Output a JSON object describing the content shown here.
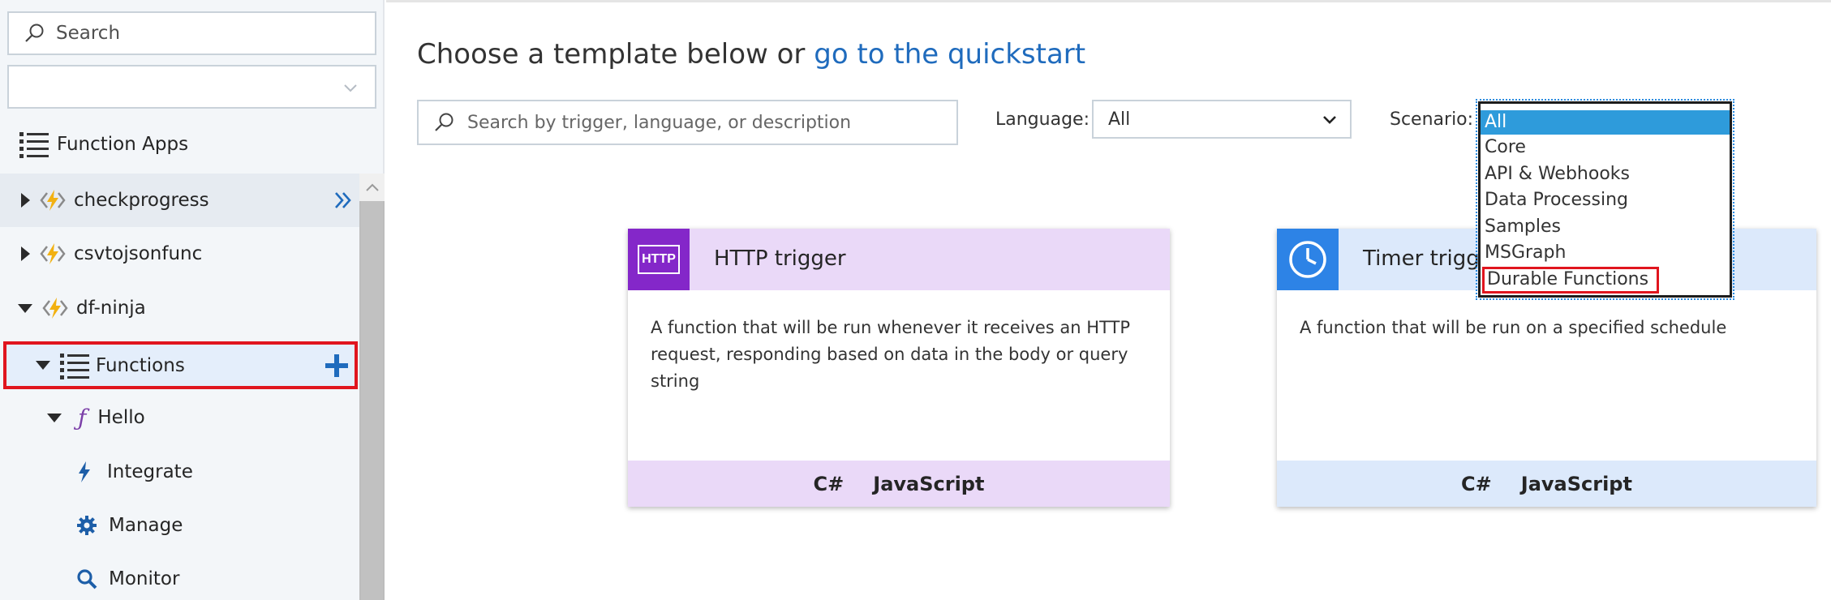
{
  "sidebar": {
    "search_placeholder": "Search",
    "subscription_value": "",
    "function_apps_label": "Function Apps",
    "tree": [
      {
        "label": "checkprogress"
      },
      {
        "label": "csvtojsonfunc"
      },
      {
        "label": "df-ninja"
      },
      {
        "label": "Functions"
      },
      {
        "label": "Hello"
      },
      {
        "label": "Integrate"
      },
      {
        "label": "Manage"
      },
      {
        "label": "Monitor"
      }
    ]
  },
  "main": {
    "heading_text": "Choose a template below or",
    "heading_link": "go to the quickstart",
    "search_placeholder": "Search by trigger, language, or description",
    "language_label": "Language:",
    "language_value": "All",
    "scenario_label": "Scenario:",
    "scenario_options": [
      "All",
      "Core",
      "API & Webhooks",
      "Data Processing",
      "Samples",
      "MSGraph",
      "Durable Functions"
    ]
  },
  "cards": [
    {
      "title": "HTTP trigger",
      "icon_text": "HTTP",
      "description": "A function that will be run whenever it receives an HTTP request, responding based on data in the body or query string",
      "languages": [
        "C#",
        "JavaScript"
      ]
    },
    {
      "title": "Timer trigger",
      "description": "A function that will be run on a specified schedule",
      "languages": [
        "C#",
        "JavaScript"
      ]
    }
  ],
  "colors": {
    "accent_blue": "#1f6bbd",
    "highlight_red": "#e0151e",
    "http_purple": "#8427c9",
    "timer_blue": "#2d83e6",
    "selected_option": "#2e9bdb"
  }
}
